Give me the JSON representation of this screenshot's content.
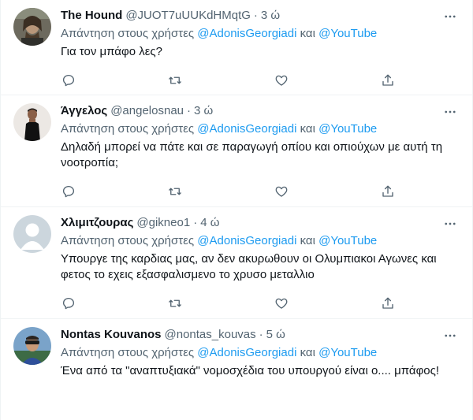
{
  "reply_prefix": "Απάντηση στους χρήστες",
  "reply_joiner": "και",
  "tweets": [
    {
      "name": "The Hound",
      "handle": "@JUOT7uUUKdHMqtG",
      "time": "3 ώ",
      "mention1": "@AdonisGeorgiadi",
      "mention2": "@YouTube",
      "text": "Για τον μπάφο λες?"
    },
    {
      "name": "Άγγελος",
      "handle": "@angelosnau",
      "time": "3 ώ",
      "mention1": "@AdonisGeorgiadi",
      "mention2": "@YouTube",
      "text": "Δηλαδή μπορεί να πάτε και σε παραγωγή οπίου και οπιούχων με αυτή τη νοοτροπία;"
    },
    {
      "name": "Χλιμιτζουρας",
      "handle": "@gikneo1",
      "time": "4 ώ",
      "mention1": "@AdonisGeorgiadi",
      "mention2": "@YouTube",
      "text": "Υπουργε της καρδιας μας, αν δεν ακυρωθουν οι Ολυμπιακοι Αγωνες και φετος το εχεις εξασφαλισμενο το χρυσο μεταλλιο"
    },
    {
      "name": "Nontas Kouvanos",
      "handle": "@nontas_kouvas",
      "time": "5 ώ",
      "mention1": "@AdonisGeorgiadi",
      "mention2": "@YouTube",
      "text": "Ένα από τα \"αναπτυξιακά\" νομοσχέδια του υπουργού είναι ο.... μπάφος!"
    }
  ],
  "colors": {
    "link": "#1d9bf0",
    "muted": "#536471",
    "text": "#0f1419",
    "border": "#eff3f4"
  },
  "icons": [
    "reply-icon",
    "retweet-icon",
    "like-icon",
    "share-icon",
    "more-icon"
  ]
}
